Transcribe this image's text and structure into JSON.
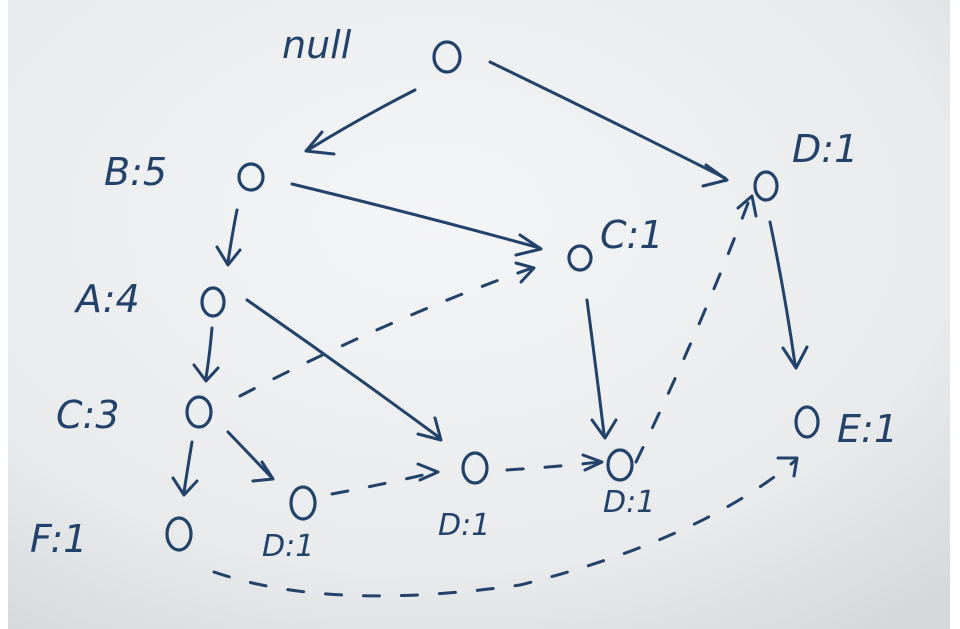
{
  "colors": {
    "ink": "#23426a",
    "paper": "#eceeef"
  },
  "nodes": [
    {
      "id": "root",
      "label": "null"
    },
    {
      "id": "b",
      "label": "B:5"
    },
    {
      "id": "d_top",
      "label": "D:1"
    },
    {
      "id": "c_mid",
      "label": "C:1"
    },
    {
      "id": "a",
      "label": "A:4"
    },
    {
      "id": "c",
      "label": "C:3"
    },
    {
      "id": "e_right",
      "label": "E:1"
    },
    {
      "id": "e_left",
      "label": "F:1"
    },
    {
      "id": "d_a",
      "label": "D:1"
    },
    {
      "id": "d_b",
      "label": "D:1"
    },
    {
      "id": "d_c",
      "label": "D:1"
    }
  ],
  "edges": [
    {
      "from": "root",
      "to": "b",
      "style": "solid"
    },
    {
      "from": "root",
      "to": "d_top",
      "style": "solid"
    },
    {
      "from": "b",
      "to": "a",
      "style": "solid"
    },
    {
      "from": "b",
      "to": "c_mid",
      "style": "solid"
    },
    {
      "from": "a",
      "to": "c",
      "style": "solid"
    },
    {
      "from": "a",
      "to": "d_b",
      "style": "solid"
    },
    {
      "from": "c",
      "to": "e_left",
      "style": "solid"
    },
    {
      "from": "c",
      "to": "d_a",
      "style": "solid"
    },
    {
      "from": "c_mid",
      "to": "d_c",
      "style": "solid"
    },
    {
      "from": "d_top",
      "to": "e_right",
      "style": "solid"
    },
    {
      "from": "c",
      "to": "c_mid",
      "style": "dashed"
    },
    {
      "from": "d_a",
      "to": "d_b",
      "style": "dashed"
    },
    {
      "from": "d_b",
      "to": "d_c",
      "style": "dashed"
    },
    {
      "from": "d_c",
      "to": "d_top",
      "style": "dashed"
    },
    {
      "from": "e_left",
      "to": "e_right",
      "style": "dashed"
    }
  ]
}
